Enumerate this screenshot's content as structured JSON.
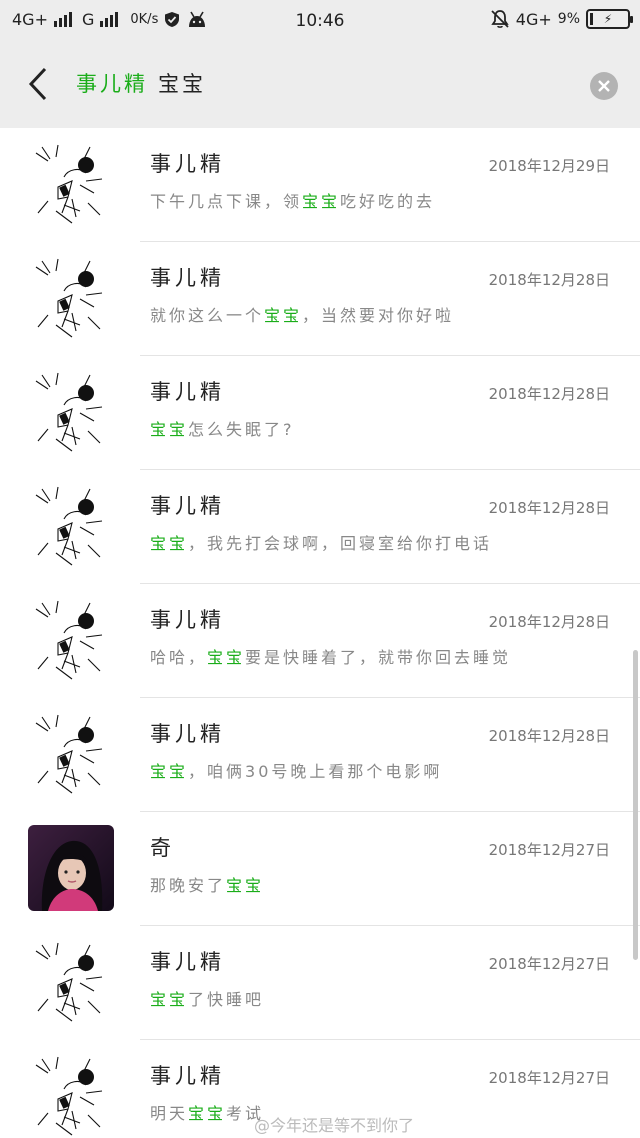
{
  "status_bar": {
    "network_1": "4G+",
    "network_2": "G",
    "speed": "0K/s",
    "time": "10:46",
    "network_right": "4G+",
    "battery": "9%",
    "battery_level": 0.09,
    "icons": [
      "signal-icon",
      "shield-icon",
      "android-icon",
      "mute-icon",
      "battery-icon"
    ]
  },
  "search": {
    "keyword_contact": "事儿精",
    "keyword_text": "宝宝"
  },
  "colors": {
    "highlight": "#1aad19",
    "header_bg": "#ededed"
  },
  "results": [
    {
      "name": "事儿精",
      "date": "2018年12月29日",
      "avatar": "sketch",
      "parts": [
        [
          "下午几点下课，领",
          false
        ],
        [
          "宝宝",
          true
        ],
        [
          "吃好吃的去",
          false
        ]
      ]
    },
    {
      "name": "事儿精",
      "date": "2018年12月28日",
      "avatar": "sketch",
      "parts": [
        [
          "就你这么一个",
          false
        ],
        [
          "宝宝",
          true
        ],
        [
          "，当然要对你好啦",
          false
        ]
      ]
    },
    {
      "name": "事儿精",
      "date": "2018年12月28日",
      "avatar": "sketch",
      "parts": [
        [
          "宝宝",
          true
        ],
        [
          "怎么失眠了?",
          false
        ]
      ]
    },
    {
      "name": "事儿精",
      "date": "2018年12月28日",
      "avatar": "sketch",
      "parts": [
        [
          "宝宝",
          true
        ],
        [
          "，我先打会球啊，回寝室给你打电话",
          false
        ]
      ]
    },
    {
      "name": "事儿精",
      "date": "2018年12月28日",
      "avatar": "sketch",
      "parts": [
        [
          "哈哈，",
          false
        ],
        [
          "宝宝",
          true
        ],
        [
          "要是快睡着了，就带你回去睡觉",
          false
        ]
      ]
    },
    {
      "name": "事儿精",
      "date": "2018年12月28日",
      "avatar": "sketch",
      "parts": [
        [
          "宝宝",
          true
        ],
        [
          "，咱俩30号晚上看那个电影啊",
          false
        ]
      ]
    },
    {
      "name": "奇",
      "date": "2018年12月27日",
      "avatar": "photo",
      "parts": [
        [
          "那晚安了",
          false
        ],
        [
          "宝宝",
          true
        ]
      ]
    },
    {
      "name": "事儿精",
      "date": "2018年12月27日",
      "avatar": "sketch",
      "parts": [
        [
          "宝宝",
          true
        ],
        [
          "了快睡吧",
          false
        ]
      ]
    },
    {
      "name": "事儿精",
      "date": "2018年12月27日",
      "avatar": "sketch",
      "parts": [
        [
          "明天",
          false
        ],
        [
          "宝宝",
          true
        ],
        [
          "考试",
          false
        ]
      ]
    }
  ],
  "watermark": "@今年还是等不到你了"
}
